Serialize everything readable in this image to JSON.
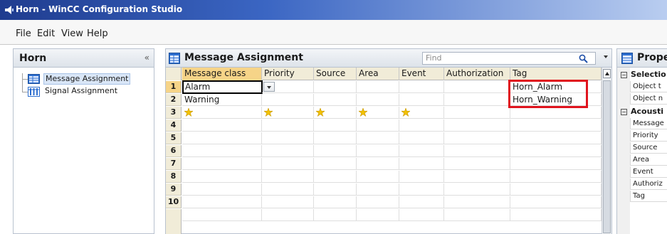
{
  "window": {
    "title": "Horn - WinCC Configuration Studio"
  },
  "menu": {
    "items": [
      "File",
      "Edit",
      "View",
      "Help"
    ]
  },
  "nav": {
    "title": "Horn",
    "collapse_glyph": "«",
    "items": [
      {
        "label": "Message Assignment",
        "icon": "table-icon",
        "selected": true
      },
      {
        "label": "Signal Assignment",
        "icon": "signal-table-icon",
        "selected": false
      }
    ]
  },
  "editor": {
    "title": "Message Assignment",
    "find_placeholder": "Find",
    "columns": [
      "Message class",
      "Priority",
      "Source",
      "Area",
      "Event",
      "Authorization",
      "Tag"
    ],
    "rows": [
      {
        "num": "1",
        "cells": [
          "Alarm",
          "",
          "",
          "",
          "",
          "",
          "Horn_Alarm"
        ]
      },
      {
        "num": "2",
        "cells": [
          "Warning",
          "",
          "",
          "",
          "",
          "",
          "Horn_Warning"
        ]
      },
      {
        "num": "3",
        "cells": [
          "",
          "",
          "",
          "",
          "",
          "",
          ""
        ]
      },
      {
        "num": "4",
        "cells": [
          "",
          "",
          "",
          "",
          "",
          "",
          ""
        ]
      },
      {
        "num": "5",
        "cells": [
          "",
          "",
          "",
          "",
          "",
          "",
          ""
        ]
      },
      {
        "num": "6",
        "cells": [
          "",
          "",
          "",
          "",
          "",
          "",
          ""
        ]
      },
      {
        "num": "7",
        "cells": [
          "",
          "",
          "",
          "",
          "",
          "",
          ""
        ]
      },
      {
        "num": "8",
        "cells": [
          "",
          "",
          "",
          "",
          "",
          "",
          ""
        ]
      },
      {
        "num": "9",
        "cells": [
          "",
          "",
          "",
          "",
          "",
          "",
          ""
        ]
      },
      {
        "num": "10",
        "cells": [
          "",
          "",
          "",
          "",
          "",
          "",
          ""
        ]
      }
    ]
  },
  "properties": {
    "title": "Prope",
    "categories": [
      {
        "label": "Selectio",
        "toggle": "−"
      },
      {
        "label": "Acousti",
        "toggle": "−"
      }
    ],
    "selection_rows": [
      "Object t",
      "Object n"
    ],
    "acoustic_rows": [
      "Message",
      "Priority",
      "Source",
      "Area",
      "Event",
      "Authoriz",
      "Tag"
    ]
  },
  "colors": {
    "highlight": "#e0141e",
    "header_bg": "#f1ecd8",
    "selected_header": "#f6d488",
    "title_bar": "#1f3c8f"
  }
}
